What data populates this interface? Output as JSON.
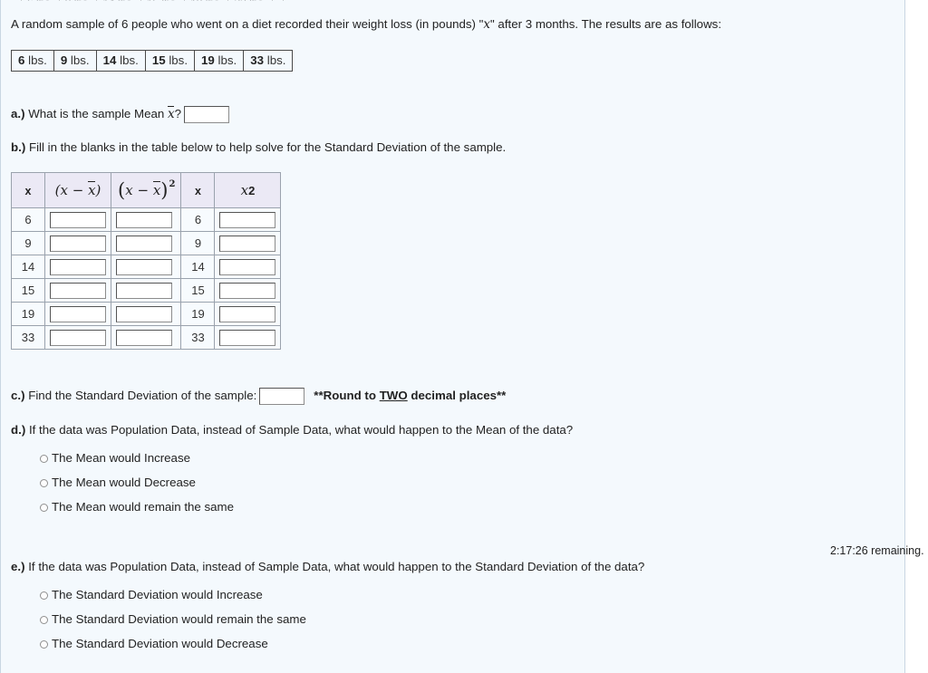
{
  "intro": {
    "text_before_var": "A random sample of 6 people who went on a diet recorded their weight loss (in pounds) \"",
    "var": "x",
    "text_after_var": "\" after 3 months. The results are as follows:"
  },
  "data_strip": {
    "unit": "lbs.",
    "values": [
      "6",
      "9",
      "14",
      "15",
      "19",
      "33"
    ]
  },
  "questions": {
    "a": {
      "label": "a.)",
      "text": "What is the sample Mean",
      "var": "x",
      "text_after": "?",
      "input_value": "",
      "input_placeholder": ""
    },
    "b": {
      "label": "b.)",
      "text": "Fill in the blanks in the table below to help solve for the Standard Deviation of the sample."
    },
    "c": {
      "label": "c.)",
      "text": "Find the Standard Deviation of the sample:",
      "input_value": "",
      "note_prefix": "**Round to ",
      "note_emphasis": "TWO",
      "note_suffix": " decimal places**"
    },
    "d": {
      "label": "d.)",
      "text": "If the data was Population Data, instead of Sample Data, what would happen to the Mean of the data?",
      "options": [
        "The Mean would Increase",
        "The Mean would Decrease",
        "The Mean would remain the same"
      ]
    },
    "e": {
      "label": "e.)",
      "text": "If the data was Population Data, instead of Sample Data, what would happen to the Standard Deviation of the data?",
      "options": [
        "The Standard Deviation would Increase",
        "The Standard Deviation would remain the same",
        "The Standard Deviation would Decrease"
      ]
    }
  },
  "work_table": {
    "headers": {
      "col1": "x",
      "col2_open": "(",
      "col2_x": "x",
      "col2_minus": "−",
      "col2_xbar": "x",
      "col2_close": ")",
      "col3_sup": "2",
      "col4": "x",
      "col5_base": "x",
      "col5_sup": "2"
    },
    "rows": [
      {
        "x": "6",
        "dev": "",
        "devsq": "",
        "x2label": "6",
        "xsq": ""
      },
      {
        "x": "9",
        "dev": "",
        "devsq": "",
        "x2label": "9",
        "xsq": ""
      },
      {
        "x": "14",
        "dev": "",
        "devsq": "",
        "x2label": "14",
        "xsq": ""
      },
      {
        "x": "15",
        "dev": "",
        "devsq": "",
        "x2label": "15",
        "xsq": ""
      },
      {
        "x": "19",
        "dev": "",
        "devsq": "",
        "x2label": "19",
        "xsq": ""
      },
      {
        "x": "33",
        "dev": "",
        "devsq": "",
        "x2label": "33",
        "xsq": ""
      }
    ]
  },
  "timer": {
    "text": "2:17:26 remaining."
  },
  "colors": {
    "page_background": "#f4f9fd",
    "panel_border": "#c9d6e2",
    "table_header_background": "#ebe9f5",
    "table_border": "#9aa2ad",
    "text": "#222222"
  }
}
